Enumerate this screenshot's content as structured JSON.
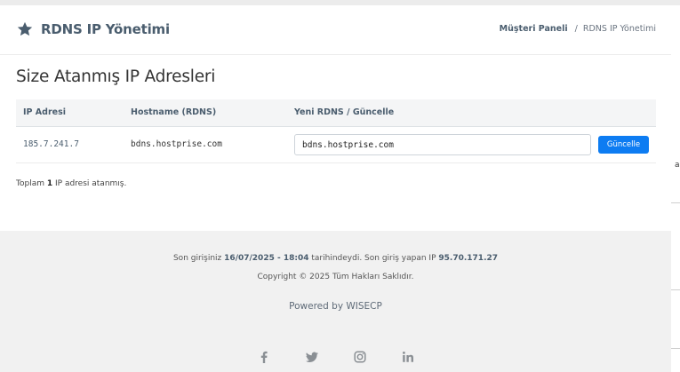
{
  "header": {
    "title": "RDNS IP Yönetimi",
    "title_icon": "star-icon",
    "breadcrumb": {
      "panel_label": "Müşteri Paneli",
      "separator": "/",
      "current_label": "RDNS IP Yönetimi"
    }
  },
  "main": {
    "section_title": "Size Atanmış IP Adresleri",
    "table": {
      "columns": [
        "IP Adresi",
        "Hostname (RDNS)",
        "Yeni RDNS / Güncelle"
      ],
      "rows": [
        {
          "ip": "185.7.241.7",
          "hostname": "bdns.hostprise.com",
          "input_value": "bdns.hostprise.com",
          "button_label": "Güncelle"
        }
      ]
    },
    "summary": {
      "prefix": "Toplam",
      "count": "1",
      "suffix": "IP adresi atanmış."
    }
  },
  "footer": {
    "login_prefix": "Son girişiniz",
    "login_datetime": "16/07/2025 - 18:04",
    "login_middle": "tarihindeydi. Son giriş yapan IP",
    "login_ip": "95.70.171.27",
    "copyright": "Copyright © 2025 Tüm Hakları Saklıdır.",
    "powered_by": "Powered by WISECP",
    "social_icons": [
      "facebook-icon",
      "twitter-icon",
      "instagram-icon",
      "linkedin-icon"
    ]
  },
  "colors": {
    "accent": "#0d7cf2",
    "heading": "#4a5d6e",
    "page_background": "#f1f1f1",
    "social_icon": "#8a8f94"
  }
}
